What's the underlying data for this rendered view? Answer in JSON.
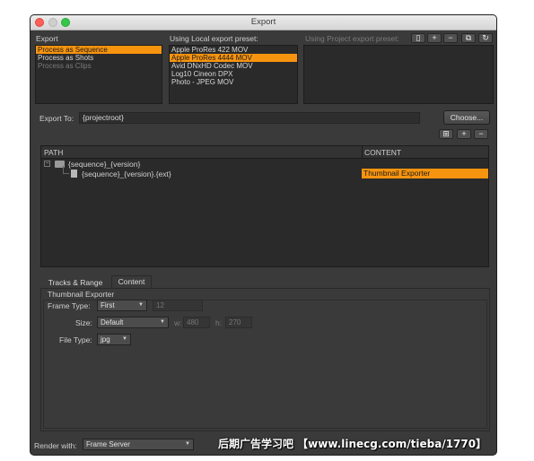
{
  "window": {
    "title": "Export"
  },
  "export_section": {
    "label": "Export",
    "items": [
      "Process as Sequence",
      "Process as Shots",
      "Process as Clips"
    ],
    "selected_index": 0
  },
  "local_presets": {
    "label": "Using Local export preset:",
    "items": [
      "Apple ProRes 422 MOV",
      "Apple ProRes 4444 MOV",
      "Avid DNxHD Codec MOV",
      "Log10 Cineon DPX",
      "Photo - JPEG MOV"
    ],
    "selected_index": 1
  },
  "project_presets": {
    "label": "Using Project export preset:",
    "toolbar_icons": [
      "new-document-icon",
      "add-icon",
      "remove-icon",
      "copy-icon",
      "refresh-icon"
    ],
    "toolbar_glyphs": [
      "▯",
      "+",
      "−",
      "⧉",
      "↻"
    ]
  },
  "export_to": {
    "label": "Export To:",
    "value": "{projectroot}",
    "choose_label": "Choose..."
  },
  "path_toolbar": {
    "icons": [
      "add-folder-icon",
      "add-icon",
      "remove-icon"
    ],
    "glyphs": [
      "⊞",
      "+",
      "−"
    ]
  },
  "path_table": {
    "headers": [
      "PATH",
      "CONTENT"
    ],
    "rows": [
      {
        "path": "{sequence}_{version}",
        "content": "",
        "type": "folder",
        "expand": "−"
      },
      {
        "path": "{sequence}_{version}.{ext}",
        "content": "Thumbnail Exporter",
        "type": "file",
        "expand": ""
      }
    ]
  },
  "tabs": [
    "Tracks & Range",
    "Content"
  ],
  "active_tab": 1,
  "content_panel": {
    "group_title": "Thumbnail Exporter",
    "frame_type": {
      "label": "Frame Type:",
      "value": "First",
      "number": "12"
    },
    "size": {
      "label": "Size:",
      "value": "Default",
      "w_label": "w:",
      "w_value": "480",
      "h_label": "h:",
      "h_value": "270"
    },
    "file_type": {
      "label": "File Type:",
      "value": "jpg"
    }
  },
  "render_with": {
    "label": "Render with:",
    "value": "Frame Server"
  },
  "overlay_text": "后期广告学习吧 【www.linecg.com/tieba/1770】",
  "colors": {
    "accent": "#f7940f",
    "window_bg": "#3a3a3a",
    "list_bg": "#2a2a2a"
  }
}
